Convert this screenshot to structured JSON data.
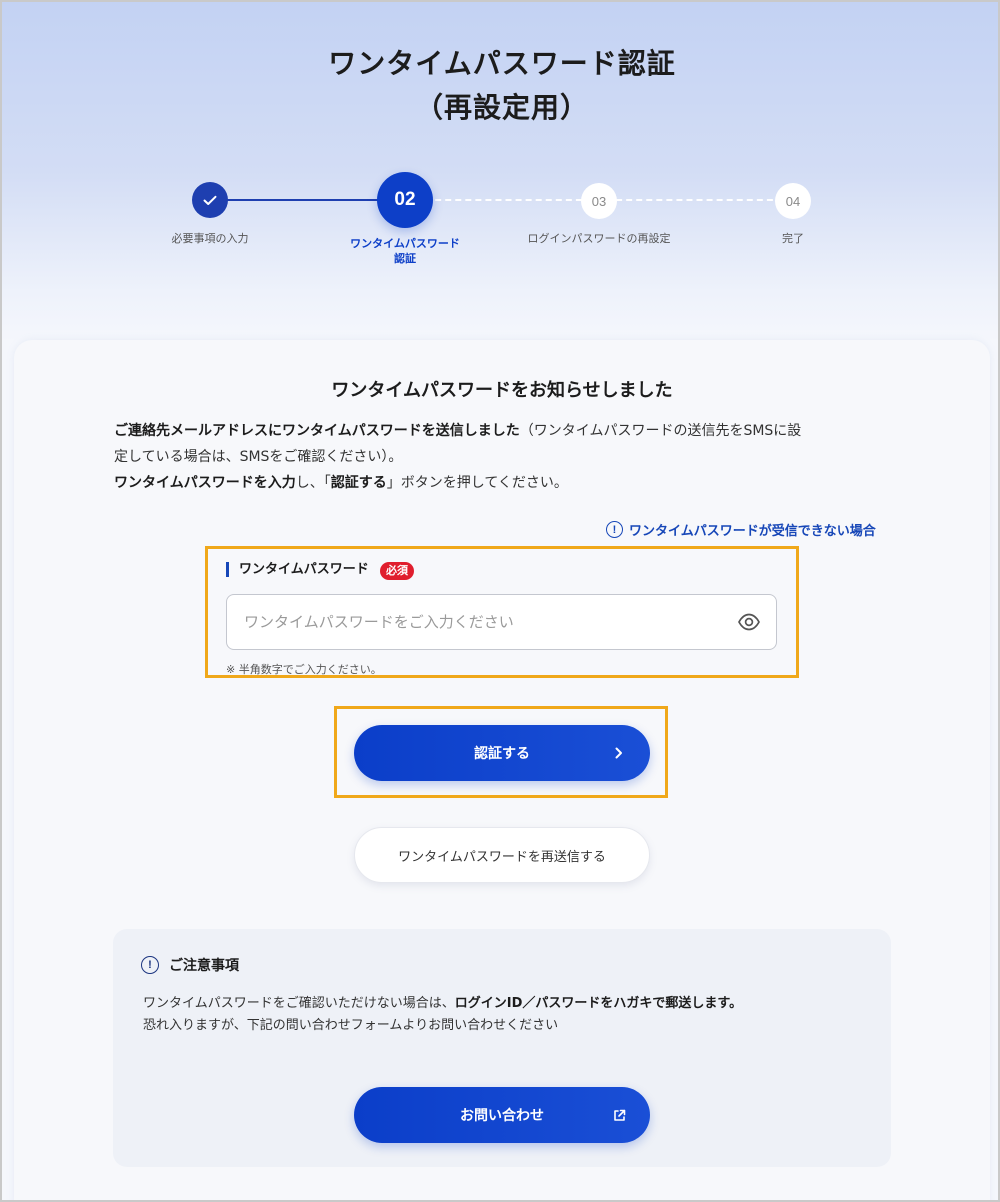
{
  "header": {
    "title_line1": "ワンタイムパスワード認証",
    "title_line2": "（再設定用）"
  },
  "stepper": {
    "current_step": 2,
    "total_steps": 4,
    "steps": [
      {
        "number": "01",
        "label": "必要事項の入力",
        "status": "completed",
        "icon": "check-icon"
      },
      {
        "number": "02",
        "label_line1": "ワンタイムパスワード",
        "label_line2": "認証",
        "status": "current"
      },
      {
        "number": "03",
        "label": "ログインパスワードの再設定",
        "status": "upcoming"
      },
      {
        "number": "04",
        "label": "完了",
        "status": "upcoming"
      }
    ]
  },
  "main": {
    "title": "ワンタイムパスワードをお知らせしました",
    "desc": {
      "line1_bold": "ご連絡先メールアドレスにワンタイムパスワードを送信しました",
      "line1_rest": "（ワンタイムパスワードの送信先をSMSに設",
      "line2": "定している場合は、SMSをご確認ください）。",
      "line3_bold_a": "ワンタイムパスワードを入力",
      "line3_mid": "し、「",
      "line3_bold_b": "認証する",
      "line3_rest": "」ボタンを押してください。"
    },
    "help_link": "ワンタイムパスワードが受信できない場合",
    "otp_field": {
      "label": "ワンタイムパスワード",
      "required_badge": "必須",
      "value": "",
      "placeholder": "ワンタイムパスワードをご入力ください",
      "hint": "※ 半角数字でご入力ください。"
    },
    "auth_button": "認証する",
    "resend_button": "ワンタイムパスワードを再送信する"
  },
  "notice": {
    "title": "ご注意事項",
    "line1_a": "ワンタイムパスワードをご確認いただけない場合は、",
    "line1_bold": "ログインID／パスワードをハガキで郵送します。",
    "line2": "恐れ入りますが、下記の問い合わせフォームよりお問い合わせください",
    "contact_button": "お問い合わせ"
  },
  "colors": {
    "accent": "#0D3FC8",
    "link": "#1747B8",
    "required": "#E01E2D",
    "highlight_box": "#F0A81A"
  }
}
